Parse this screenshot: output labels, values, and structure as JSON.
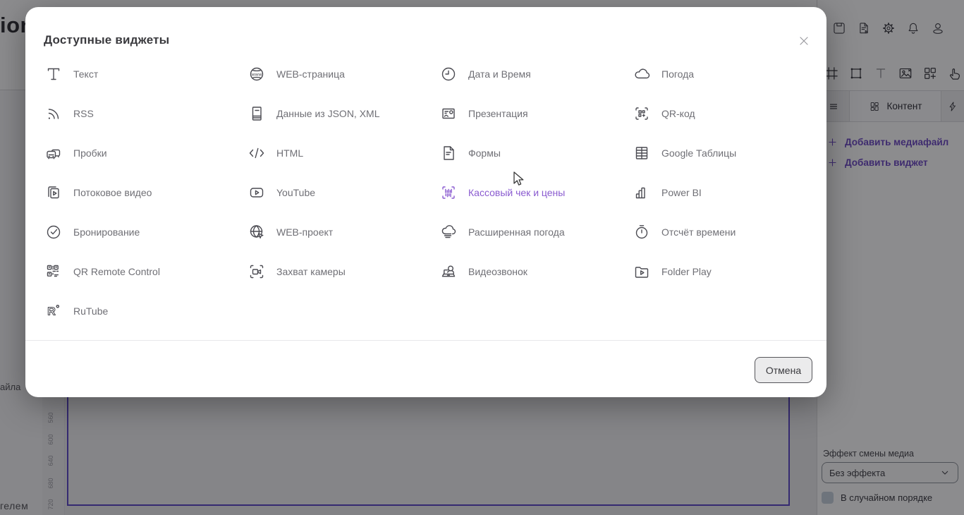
{
  "background": {
    "logo_fragment": "ion",
    "left_cut_text_1": "айла",
    "left_cut_text_2": "гелем",
    "ruler_ticks": [
      "560",
      "600",
      "640",
      "680",
      "720"
    ],
    "topbar_icons": [
      "save",
      "document-play",
      "settings-gear",
      "bell",
      "user"
    ],
    "toolbar_icons": [
      "frame",
      "bounding-box",
      "text-tool",
      "image",
      "add-widget-grid",
      "hand-pointer"
    ],
    "tabs": {
      "content_label": "Контент"
    },
    "links": [
      {
        "label": "Добавить медиафайл"
      },
      {
        "label": "Добавить виджет"
      }
    ],
    "media_effect": {
      "label": "Эффект смены медиа",
      "selected": "Без эффекта",
      "checkbox_label": "В случайном порядке",
      "checkbox_checked": false
    },
    "accent_purple": "#6d49c4",
    "canvas_border_color": "#5b46c9"
  },
  "modal": {
    "title": "Доступные виджеты",
    "cancel_label": "Отмена",
    "highlight_color": "#8a5bd0",
    "widgets": [
      {
        "label": "Текст",
        "icon": "text"
      },
      {
        "label": "WEB-страница",
        "icon": "web-page"
      },
      {
        "label": "Дата и Время",
        "icon": "clock"
      },
      {
        "label": "Погода",
        "icon": "cloud"
      },
      {
        "label": "RSS",
        "icon": "rss"
      },
      {
        "label": "Данные из JSON, XML",
        "icon": "json-xml"
      },
      {
        "label": "Презентация",
        "icon": "presentation"
      },
      {
        "label": "QR-код",
        "icon": "qr-code"
      },
      {
        "label": "Пробки",
        "icon": "traffic"
      },
      {
        "label": "HTML",
        "icon": "html"
      },
      {
        "label": "Формы",
        "icon": "forms"
      },
      {
        "label": "Google Таблицы",
        "icon": "google-sheets"
      },
      {
        "label": "Потоковое видео",
        "icon": "stream-video"
      },
      {
        "label": "YouTube",
        "icon": "youtube"
      },
      {
        "label": "Кассовый чек и цены",
        "icon": "receipt-barcode",
        "highlighted": true
      },
      {
        "label": "Power BI",
        "icon": "power-bi"
      },
      {
        "label": "Бронирование",
        "icon": "booking-check"
      },
      {
        "label": "WEB-проект",
        "icon": "web-project"
      },
      {
        "label": "Расширенная погода",
        "icon": "weather-extended"
      },
      {
        "label": "Отсчёт времени",
        "icon": "stopwatch"
      },
      {
        "label": "QR Remote Control",
        "icon": "qr-remote"
      },
      {
        "label": "Захват камеры",
        "icon": "camera-capture"
      },
      {
        "label": "Видеозвонок",
        "icon": "video-call"
      },
      {
        "label": "Folder Play",
        "icon": "folder-play"
      },
      {
        "label": "RuTube",
        "icon": "rutube"
      }
    ]
  }
}
